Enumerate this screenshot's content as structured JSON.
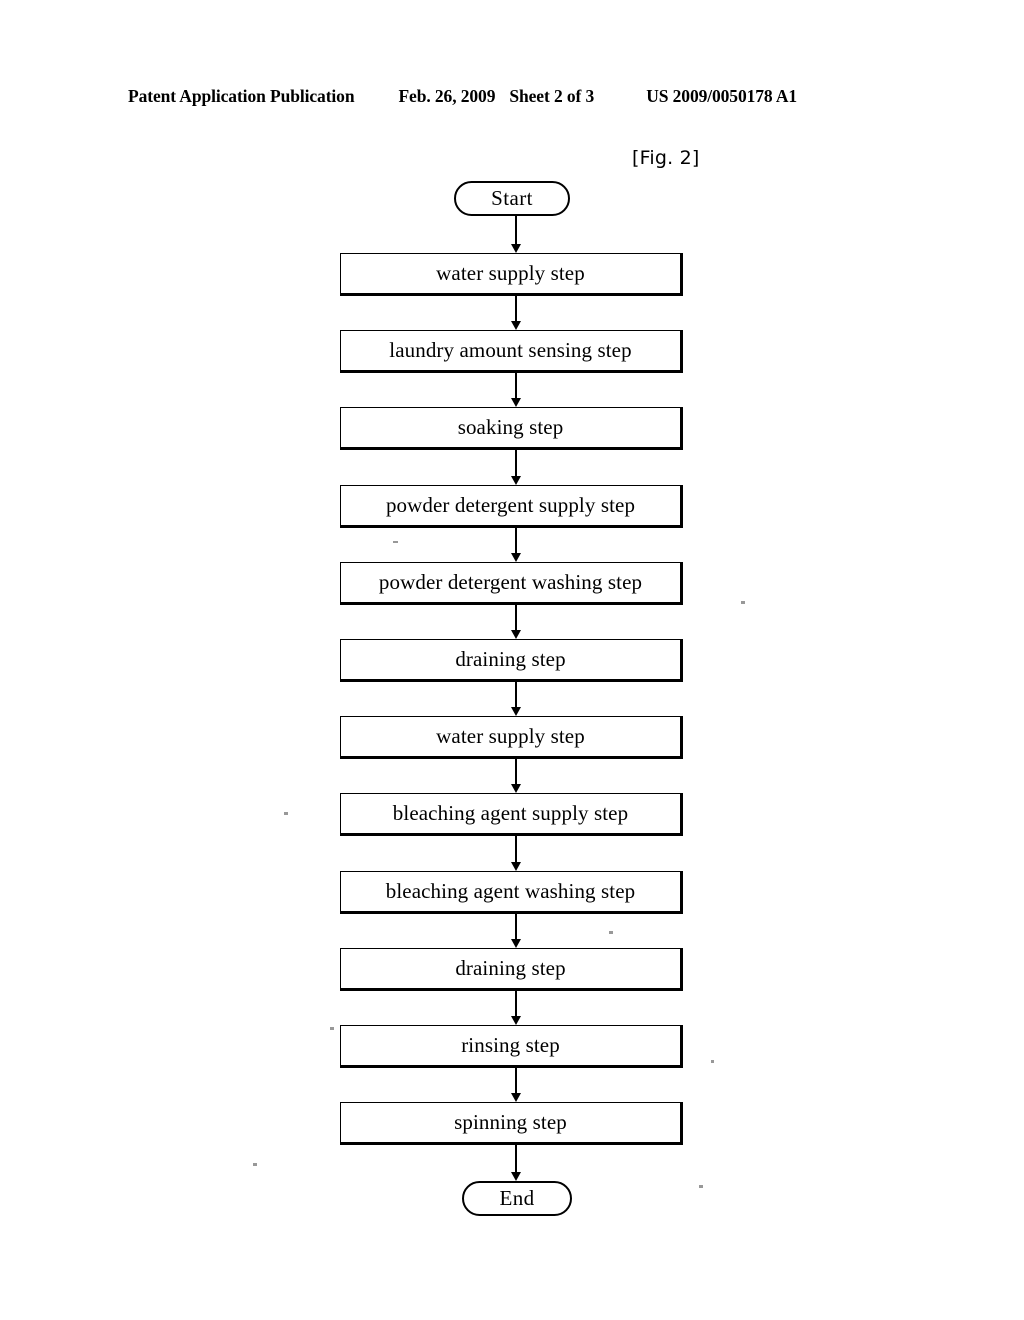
{
  "header": {
    "publication": "Patent Application Publication",
    "date": "Feb. 26, 2009",
    "sheet": "Sheet 2 of 3",
    "doc_number": "US 2009/0050178 A1"
  },
  "figure": {
    "label": "[Fig. 2]"
  },
  "flowchart": {
    "type": "process-flow",
    "orientation": "vertical",
    "start": {
      "label": "Start",
      "shape": "terminator"
    },
    "end": {
      "label": "End",
      "shape": "terminator"
    },
    "steps": [
      {
        "label": "water supply step",
        "shape": "process"
      },
      {
        "label": "laundry amount sensing step",
        "shape": "process"
      },
      {
        "label": "soaking step",
        "shape": "process"
      },
      {
        "label": "powder detergent supply step",
        "shape": "process"
      },
      {
        "label": "powder detergent washing step",
        "shape": "process"
      },
      {
        "label": "draining step",
        "shape": "process"
      },
      {
        "label": "water supply step",
        "shape": "process"
      },
      {
        "label": "bleaching agent supply step",
        "shape": "process"
      },
      {
        "label": "bleaching agent washing step",
        "shape": "process"
      },
      {
        "label": "draining step",
        "shape": "process"
      },
      {
        "label": "rinsing step",
        "shape": "process"
      },
      {
        "label": "spinning step",
        "shape": "process"
      }
    ]
  },
  "colors": {
    "ink": "#000000",
    "paper": "#ffffff"
  }
}
